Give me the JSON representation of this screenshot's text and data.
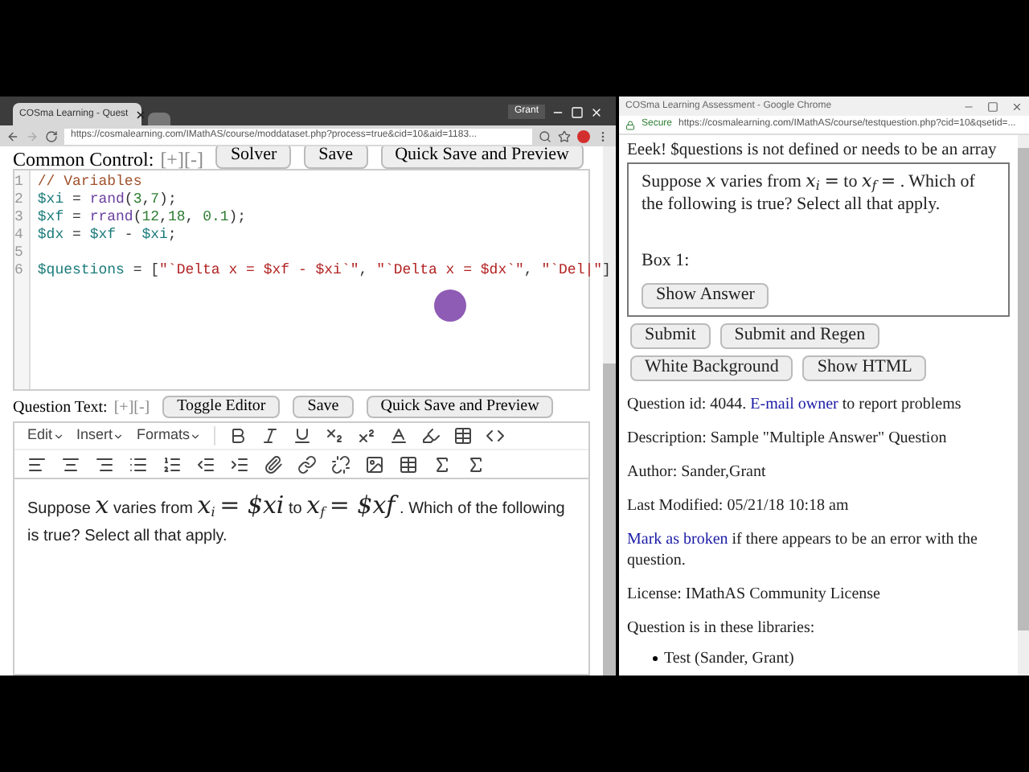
{
  "left_window": {
    "tab_title": "COSma Learning - Quest",
    "user": "Grant",
    "url": "https://cosmalearning.com/IMathAS/course/moddataset.php?process=true&cid=10&aid=1183...",
    "common_control": {
      "label": "Common Control:",
      "toggles": "[+][-]",
      "buttons": [
        "Solver",
        "Save",
        "Quick Save and Preview"
      ]
    },
    "code_lines": [
      {
        "number": "1",
        "tokens": [
          {
            "kind": "comment",
            "text": "// Variables"
          }
        ]
      },
      {
        "number": "2",
        "tokens": [
          {
            "kind": "var",
            "text": "$xi"
          },
          {
            "kind": "plain",
            "text": " = "
          },
          {
            "kind": "func",
            "text": "rand"
          },
          {
            "kind": "plain",
            "text": "("
          },
          {
            "kind": "num",
            "text": "3"
          },
          {
            "kind": "plain",
            "text": ","
          },
          {
            "kind": "num",
            "text": "7"
          },
          {
            "kind": "plain",
            "text": ");"
          }
        ]
      },
      {
        "number": "3",
        "tokens": [
          {
            "kind": "var",
            "text": "$xf"
          },
          {
            "kind": "plain",
            "text": " = "
          },
          {
            "kind": "func",
            "text": "rrand"
          },
          {
            "kind": "plain",
            "text": "("
          },
          {
            "kind": "num",
            "text": "12"
          },
          {
            "kind": "plain",
            "text": ","
          },
          {
            "kind": "num",
            "text": "18"
          },
          {
            "kind": "plain",
            "text": ", "
          },
          {
            "kind": "num",
            "text": "0.1"
          },
          {
            "kind": "plain",
            "text": ");"
          }
        ]
      },
      {
        "number": "4",
        "tokens": [
          {
            "kind": "var",
            "text": "$dx"
          },
          {
            "kind": "plain",
            "text": " = "
          },
          {
            "kind": "var",
            "text": "$xf"
          },
          {
            "kind": "plain",
            "text": " - "
          },
          {
            "kind": "var",
            "text": "$xi"
          },
          {
            "kind": "plain",
            "text": ";"
          }
        ]
      },
      {
        "number": "5"
      },
      {
        "number": "6",
        "tokens": [
          {
            "kind": "var",
            "text": "$questions"
          },
          {
            "kind": "plain",
            "text": " = ["
          },
          {
            "kind": "string",
            "text": "\"`Delta x = $xf - $xi`\""
          },
          {
            "kind": "plain",
            "text": ", "
          },
          {
            "kind": "string",
            "text": "\"`Delta x = $dx`\""
          },
          {
            "kind": "plain",
            "text": ", "
          },
          {
            "kind": "string",
            "text": "\"`Del|\""
          },
          {
            "kind": "plain",
            "text": "]"
          }
        ]
      }
    ],
    "question_text": {
      "label": "Question Text:",
      "toggles": "[+][-]",
      "buttons": [
        "Toggle Editor",
        "Save",
        "Quick Save and Preview"
      ]
    },
    "editor": {
      "menus": [
        "Edit",
        "Insert",
        "Formats"
      ],
      "body": [
        {
          "kind": "text",
          "text": "Suppose"
        },
        {
          "kind": "math",
          "text": "x"
        },
        {
          "kind": "text",
          "text": "varies from"
        },
        {
          "kind": "math",
          "text": "x",
          "sub": "i"
        },
        {
          "kind": "math",
          "text": "= $xi"
        },
        {
          "kind": "text",
          "text": "to"
        },
        {
          "kind": "math",
          "text": "x",
          "sub": "f"
        },
        {
          "kind": "math",
          "text": "= $xf"
        },
        {
          "kind": "text",
          "text": ". Which of the following is true? Select all that apply."
        }
      ]
    }
  },
  "right_window": {
    "title": "COSma Learning Assessment - Google Chrome",
    "secure": "Secure",
    "url": "https://cosmalearning.com/IMathAS/course/testquestion.php?cid=10&qsetid=...",
    "error": "Eeek! $questions is not defined or needs to be an array",
    "question": [
      {
        "kind": "text",
        "text": "Suppose"
      },
      {
        "kind": "math",
        "text": "x"
      },
      {
        "kind": "text",
        "text": "varies from"
      },
      {
        "kind": "math",
        "text": "x",
        "sub": "i"
      },
      {
        "kind": "math",
        "text": "="
      },
      {
        "kind": "text",
        "text": "to"
      },
      {
        "kind": "math",
        "text": "x",
        "sub": "f"
      },
      {
        "kind": "math",
        "text": "="
      },
      {
        "kind": "text",
        "text": ". Which of the following is true? Select all that apply."
      }
    ],
    "box_label": "Box 1:",
    "show_answer": "Show Answer",
    "buttons": [
      "Submit",
      "Submit and Regen",
      "White Background",
      "Show HTML"
    ],
    "info": [
      [
        {
          "kind": "text",
          "text": "Question id: 4044. "
        },
        {
          "kind": "link",
          "text": "E-mail owner"
        },
        {
          "kind": "text",
          "text": " to report problems"
        }
      ],
      [
        {
          "kind": "text",
          "text": "Description: Sample \"Multiple Answer\" Question"
        }
      ],
      [
        {
          "kind": "text",
          "text": "Author: Sander,Grant"
        }
      ],
      [
        {
          "kind": "text",
          "text": "Last Modified: 05/21/18 10:18 am"
        }
      ],
      [
        {
          "kind": "link",
          "text": "Mark as broken"
        },
        {
          "kind": "text",
          "text": " if there appears to be an error with the question."
        }
      ],
      [
        {
          "kind": "text",
          "text": "License: IMathAS Community License"
        }
      ],
      [
        {
          "kind": "text",
          "text": "Question is in these libraries:"
        }
      ]
    ],
    "libraries": [
      "Test (Sander, Grant)"
    ]
  }
}
